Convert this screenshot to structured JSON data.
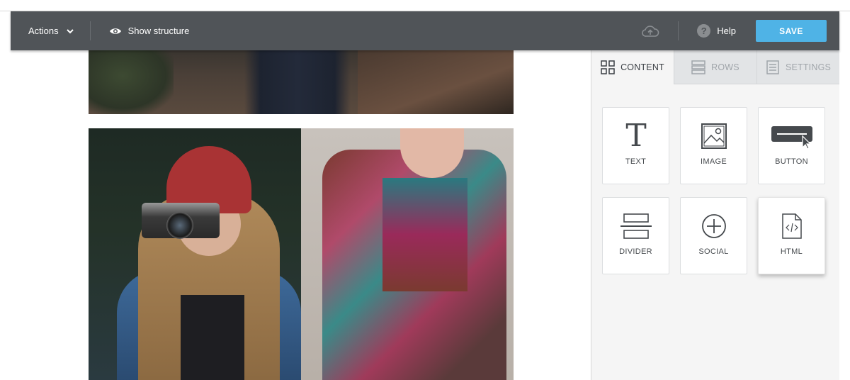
{
  "toolbar": {
    "actions_label": "Actions",
    "show_structure_label": "Show structure",
    "help_label": "Help",
    "help_badge": "?",
    "save_label": "SAVE"
  },
  "panel": {
    "tabs": [
      {
        "label": "CONTENT",
        "icon": "grid-icon",
        "active": true
      },
      {
        "label": "ROWS",
        "icon": "rows-icon",
        "active": false
      },
      {
        "label": "SETTINGS",
        "icon": "settings-doc-icon",
        "active": false
      }
    ],
    "blocks": [
      {
        "label": "TEXT",
        "icon": "text-T-icon"
      },
      {
        "label": "IMAGE",
        "icon": "image-icon"
      },
      {
        "label": "BUTTON",
        "icon": "button-icon"
      },
      {
        "label": "DIVIDER",
        "icon": "divider-icon"
      },
      {
        "label": "SOCIAL",
        "icon": "social-plus-icon"
      },
      {
        "label": "HTML",
        "icon": "html-file-icon"
      }
    ]
  },
  "colors": {
    "toolbar_bg": "#505458",
    "save_button": "#4fb3e6",
    "panel_bg": "#f5f5f5"
  }
}
